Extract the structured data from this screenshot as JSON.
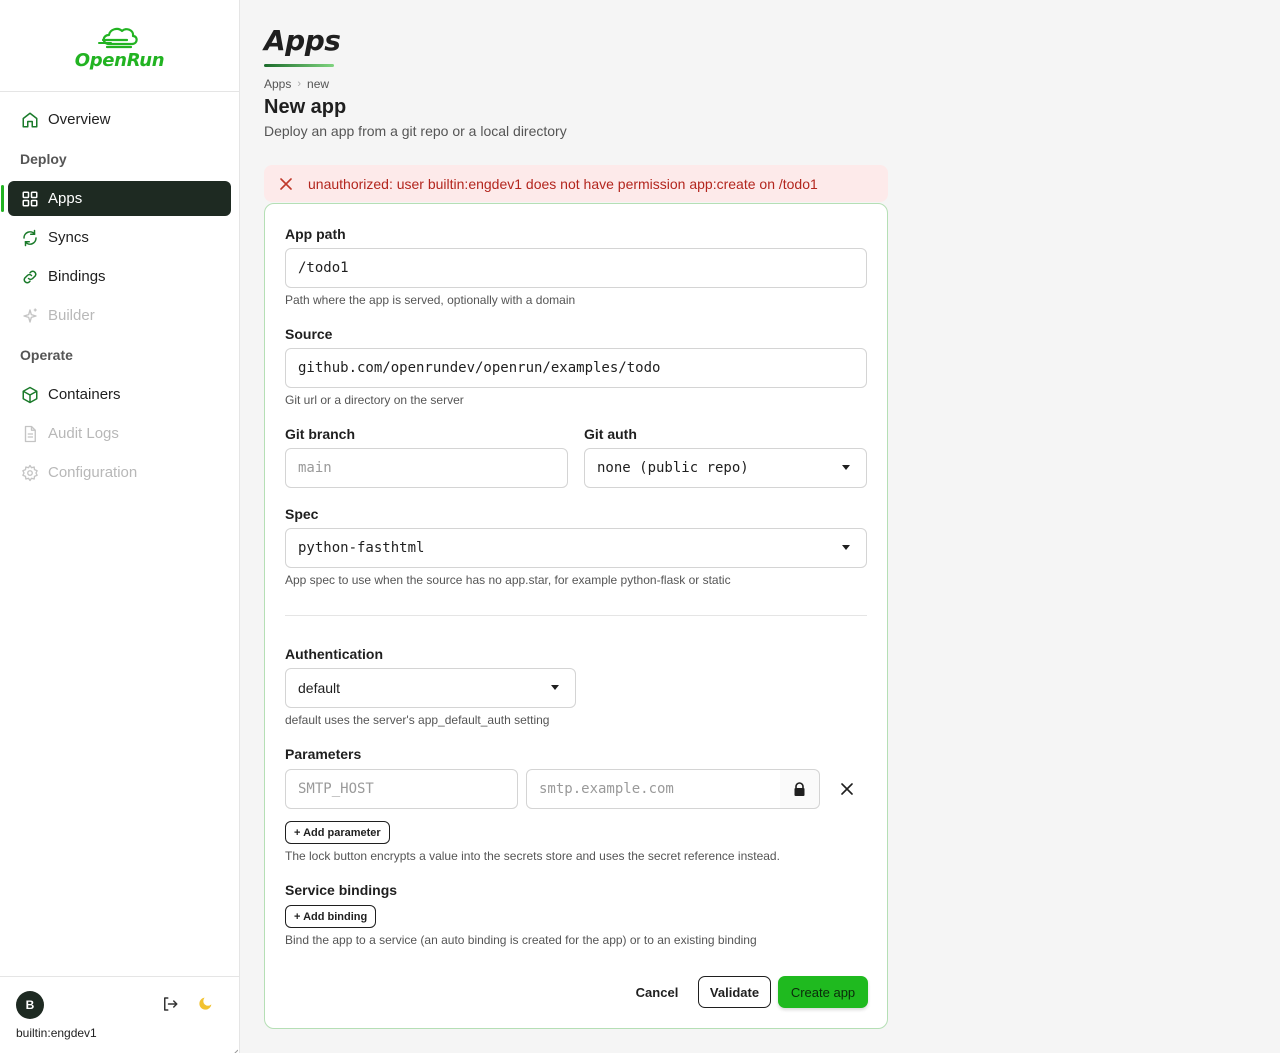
{
  "app": {
    "name": "OpenRun"
  },
  "nav": {
    "overview": "Overview",
    "deploy_section": "Deploy",
    "apps": "Apps",
    "syncs": "Syncs",
    "bindings": "Bindings",
    "builder": "Builder",
    "operate_section": "Operate",
    "containers": "Containers",
    "audit_logs": "Audit Logs",
    "configuration": "Configuration"
  },
  "user": {
    "initial": "B",
    "name": "builtin:engdev1"
  },
  "page": {
    "heading": "Apps",
    "breadcrumb": [
      "Apps",
      "new"
    ],
    "title": "New app",
    "subtitle": "Deploy an app from a git repo or a local directory"
  },
  "error": {
    "message": "unauthorized: user builtin:engdev1 does not have permission app:create on /todo1"
  },
  "form": {
    "app_path": {
      "label": "App path",
      "value": "/todo1",
      "help": "Path where the app is served, optionally with a domain"
    },
    "source": {
      "label": "Source",
      "value": "github.com/openrundev/openrun/examples/todo",
      "help": "Git url or a directory on the server"
    },
    "git_branch": {
      "label": "Git branch",
      "placeholder": "main"
    },
    "git_auth": {
      "label": "Git auth",
      "value": "none (public repo)"
    },
    "spec": {
      "label": "Spec",
      "value": "python-fasthtml",
      "help": "App spec to use when the source has no app.star, for example python-flask or static"
    },
    "authentication": {
      "label": "Authentication",
      "value": "default",
      "help": "default uses the server's app_default_auth setting"
    },
    "parameters": {
      "label": "Parameters",
      "key_placeholder": "SMTP_HOST",
      "value_placeholder": "smtp.example.com",
      "add_label": "+ Add parameter",
      "help": "The lock button encrypts a value into the secrets store and uses the secret reference instead."
    },
    "bindings": {
      "label": "Service bindings",
      "add_label": "+ Add binding",
      "help": "Bind the app to a service (an auto binding is created for the app) or to an existing binding"
    },
    "actions": {
      "cancel": "Cancel",
      "validate": "Validate",
      "create": "Create app"
    }
  },
  "colors": {
    "brand": "#22b322",
    "active_nav": "#1e2a22",
    "error_text": "#b3261e",
    "error_bg": "#fdeaea",
    "primary_button": "#1fba1f"
  }
}
